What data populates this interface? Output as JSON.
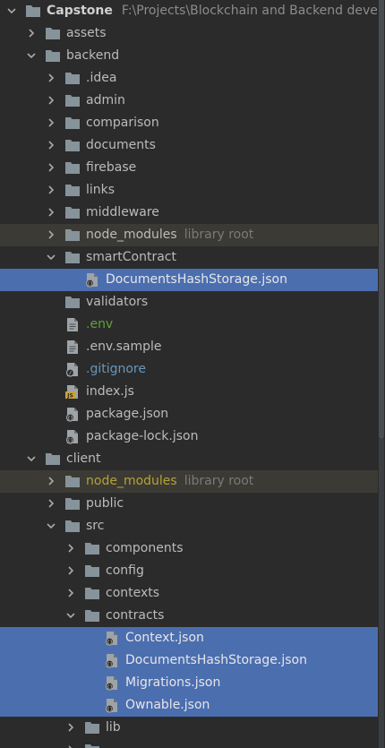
{
  "tree": [
    {
      "label": "Capstone",
      "path": "F:\\Projects\\Blockchain and Backend developn",
      "depth": 0,
      "type": "folder",
      "expanded": true,
      "bold": true
    },
    {
      "label": "assets",
      "depth": 1,
      "type": "folder",
      "expanded": false
    },
    {
      "label": "backend",
      "depth": 1,
      "type": "folder",
      "expanded": true
    },
    {
      "label": ".idea",
      "depth": 2,
      "type": "folder",
      "expanded": false
    },
    {
      "label": "admin",
      "depth": 2,
      "type": "folder",
      "expanded": false
    },
    {
      "label": "comparison",
      "depth": 2,
      "type": "folder",
      "expanded": false
    },
    {
      "label": "documents",
      "depth": 2,
      "type": "folder",
      "expanded": false
    },
    {
      "label": "firebase",
      "depth": 2,
      "type": "folder",
      "expanded": false
    },
    {
      "label": "links",
      "depth": 2,
      "type": "folder",
      "expanded": false
    },
    {
      "label": "middleware",
      "depth": 2,
      "type": "folder",
      "expanded": false
    },
    {
      "label": "node_modules",
      "hint": "library root",
      "depth": 2,
      "type": "folder",
      "expanded": false,
      "library": true
    },
    {
      "label": "smartContract",
      "depth": 2,
      "type": "folder",
      "expanded": true
    },
    {
      "label": "DocumentsHashStorage.json",
      "depth": 3,
      "type": "json",
      "selected": true
    },
    {
      "label": "validators",
      "depth": 2,
      "type": "folder"
    },
    {
      "label": ".env",
      "depth": 2,
      "type": "file",
      "color": "green"
    },
    {
      "label": ".env.sample",
      "depth": 2,
      "type": "file"
    },
    {
      "label": ".gitignore",
      "depth": 2,
      "type": "gitignore",
      "color": "blue"
    },
    {
      "label": "index.js",
      "depth": 2,
      "type": "js"
    },
    {
      "label": "package.json",
      "depth": 2,
      "type": "json"
    },
    {
      "label": "package-lock.json",
      "depth": 2,
      "type": "json"
    },
    {
      "label": "client",
      "depth": 1,
      "type": "folder",
      "expanded": true
    },
    {
      "label": "node_modules",
      "hint": "library root",
      "depth": 2,
      "type": "folder",
      "expanded": false,
      "library": true,
      "color": "yellow"
    },
    {
      "label": "public",
      "depth": 2,
      "type": "folder",
      "expanded": false
    },
    {
      "label": "src",
      "depth": 2,
      "type": "folder",
      "expanded": true
    },
    {
      "label": "components",
      "depth": 3,
      "type": "folder",
      "expanded": false
    },
    {
      "label": "config",
      "depth": 3,
      "type": "folder",
      "expanded": false
    },
    {
      "label": "contexts",
      "depth": 3,
      "type": "folder",
      "expanded": false
    },
    {
      "label": "contracts",
      "depth": 3,
      "type": "folder",
      "expanded": true
    },
    {
      "label": "Context.json",
      "depth": 4,
      "type": "json",
      "selected": true
    },
    {
      "label": "DocumentsHashStorage.json",
      "depth": 4,
      "type": "json",
      "selected": true
    },
    {
      "label": "Migrations.json",
      "depth": 4,
      "type": "json",
      "selected": true
    },
    {
      "label": "Ownable.json",
      "depth": 4,
      "type": "json",
      "selected": true
    },
    {
      "label": "lib",
      "depth": 3,
      "type": "folder",
      "expanded": false
    },
    {
      "label": "",
      "depth": 3,
      "type": "folder",
      "expanded": false
    }
  ],
  "colors": {
    "background": "#2b2b2b",
    "selection": "#4b6eaf",
    "library_row": "#3c3a34",
    "text": "#bbbbbb",
    "hint": "#7a7a7a",
    "green": "#62a03c",
    "blue": "#6897bb",
    "yellow": "#b5a235",
    "folder_icon": "#87939a"
  }
}
